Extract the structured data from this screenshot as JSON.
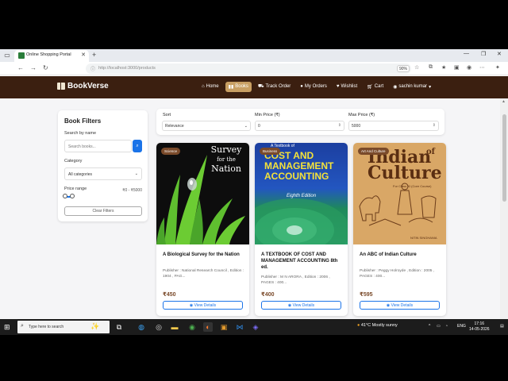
{
  "browser": {
    "tab_title": "Online Shopping Portal",
    "url": "http://localhost:3000/products",
    "zoom": "90%"
  },
  "nav": {
    "brand": "BookVerse",
    "items": [
      {
        "label": "Home",
        "icon": "home-icon",
        "active": false
      },
      {
        "label": "Books",
        "icon": "book-icon",
        "active": true
      },
      {
        "label": "Track Order",
        "icon": "truck-icon",
        "active": false
      },
      {
        "label": "My Orders",
        "icon": "user-icon",
        "active": false
      },
      {
        "label": "Wishlist",
        "icon": "heart-icon",
        "active": false
      },
      {
        "label": "Cart",
        "icon": "cart-icon",
        "active": false
      },
      {
        "label": "sachin kumar",
        "icon": "account-icon",
        "active": false
      }
    ]
  },
  "filters": {
    "title": "Book Filters",
    "search_label": "Search by name",
    "search_placeholder": "Search books...",
    "category_label": "Category",
    "category_value": "All categories",
    "price_label": "Price range",
    "price_value": "₹0 - ₹5000",
    "clear_label": "Clear Filters"
  },
  "sort": {
    "sort_label": "Sort",
    "sort_value": "Relevance",
    "min_label": "Min Price (₹)",
    "min_value": "0",
    "max_label": "Max Price (₹)",
    "max_value": "5000"
  },
  "books": [
    {
      "badge": "Science",
      "title": "A Biological Survey for the Nation",
      "desc": "Publisher : National Research Council , Edition : 1904 , PAG...",
      "price": "₹450",
      "button": "View Details",
      "cover_text": [
        "Survey",
        "for the",
        "Nation"
      ]
    },
    {
      "badge": "Business",
      "title": "A TEXTBOOK OF COST AND MANAGEMENT ACCOUNTING 8th ed.",
      "desc": "Publisher : M N ARORA , Edition : 2006 , PAGES : 400...",
      "price": "₹400",
      "button": "View Details",
      "cover_text": [
        "A Textbook of",
        "COST AND MANAGEMENT ACCOUNTING",
        "Eighth Edition"
      ]
    },
    {
      "badge": "Art And Culture",
      "title": "An ABC of Indian Culture",
      "desc": "Publisher : Peggy Holroyde , Edition : 2005 , PAGES : 400...",
      "price": "₹595",
      "button": "View Details",
      "cover_text": [
        "of",
        "Indian Culture",
        "For Class XI (Core Course)",
        "NITIN SINGHANIA"
      ]
    }
  ],
  "taskbar": {
    "search_text": "Type here to search",
    "weather": "41°C  Mostly sunny",
    "lang": "ENG",
    "time": "17:16",
    "date": "14-05-2026"
  }
}
